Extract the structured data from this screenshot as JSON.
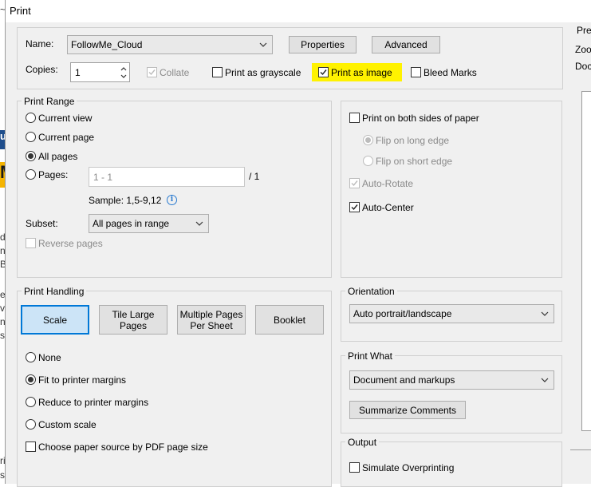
{
  "background_app": {
    "fragments": [
      "u",
      "M",
      "d",
      "nb",
      "Ba",
      "e",
      "ve",
      "n",
      "sc",
      "ri",
      "sp"
    ]
  },
  "dialog": {
    "title": "Print",
    "name_label": "Name:",
    "printer_name": "FollowMe_Cloud",
    "properties_button": "Properties",
    "advanced_button": "Advanced",
    "copies_label": "Copies:",
    "copies_value": "1",
    "collate_label": "Collate",
    "collate_checked": true,
    "grayscale_label": "Print as grayscale",
    "grayscale_checked": false,
    "print_as_image_label": "Print as image",
    "print_as_image_checked": true,
    "bleed_marks_label": "Bleed Marks",
    "bleed_marks_checked": false,
    "highlight_color": "#fff200"
  },
  "print_range": {
    "legend": "Print Range",
    "current_view": "Current view",
    "current_page": "Current page",
    "all_pages": "All pages",
    "pages_label": "Pages:",
    "pages_value": "1 - 1",
    "pages_total": "/ 1",
    "sample": "Sample: 1,5-9,12",
    "info_icon_glyph": "i",
    "subset_label": "Subset:",
    "subset_value": "All pages in range",
    "reverse_pages": "Reverse pages",
    "selected": "all_pages"
  },
  "sides": {
    "both_sides": "Print on both sides of paper",
    "flip_long": "Flip on long edge",
    "flip_short": "Flip on short edge",
    "auto_rotate": "Auto-Rotate",
    "auto_center": "Auto-Center"
  },
  "print_handling": {
    "legend": "Print Handling",
    "tabs": [
      "Scale",
      "Tile Large Pages",
      "Multiple Pages Per Sheet",
      "Booklet"
    ],
    "tab_lines": {
      "scale": "Scale",
      "tile1": "Tile Large",
      "tile2": "Pages",
      "multi1": "Multiple Pages",
      "multi2": "Per Sheet",
      "booklet": "Booklet"
    },
    "selected_tab": "Scale",
    "none": "None",
    "fit": "Fit to printer margins",
    "reduce": "Reduce to printer margins",
    "custom": "Custom scale",
    "paper_source": "Choose paper source by PDF page size",
    "selected_option": "fit"
  },
  "orientation": {
    "legend": "Orientation",
    "value": "Auto portrait/landscape"
  },
  "print_what": {
    "legend": "Print What",
    "value": "Document and markups",
    "summarize_button": "Summarize Comments"
  },
  "output": {
    "legend": "Output",
    "simulate_overprinting": "Simulate Overprinting"
  },
  "preview": {
    "label": "Prev",
    "zoom_label": "Zoo",
    "doc_label": "Doc"
  }
}
